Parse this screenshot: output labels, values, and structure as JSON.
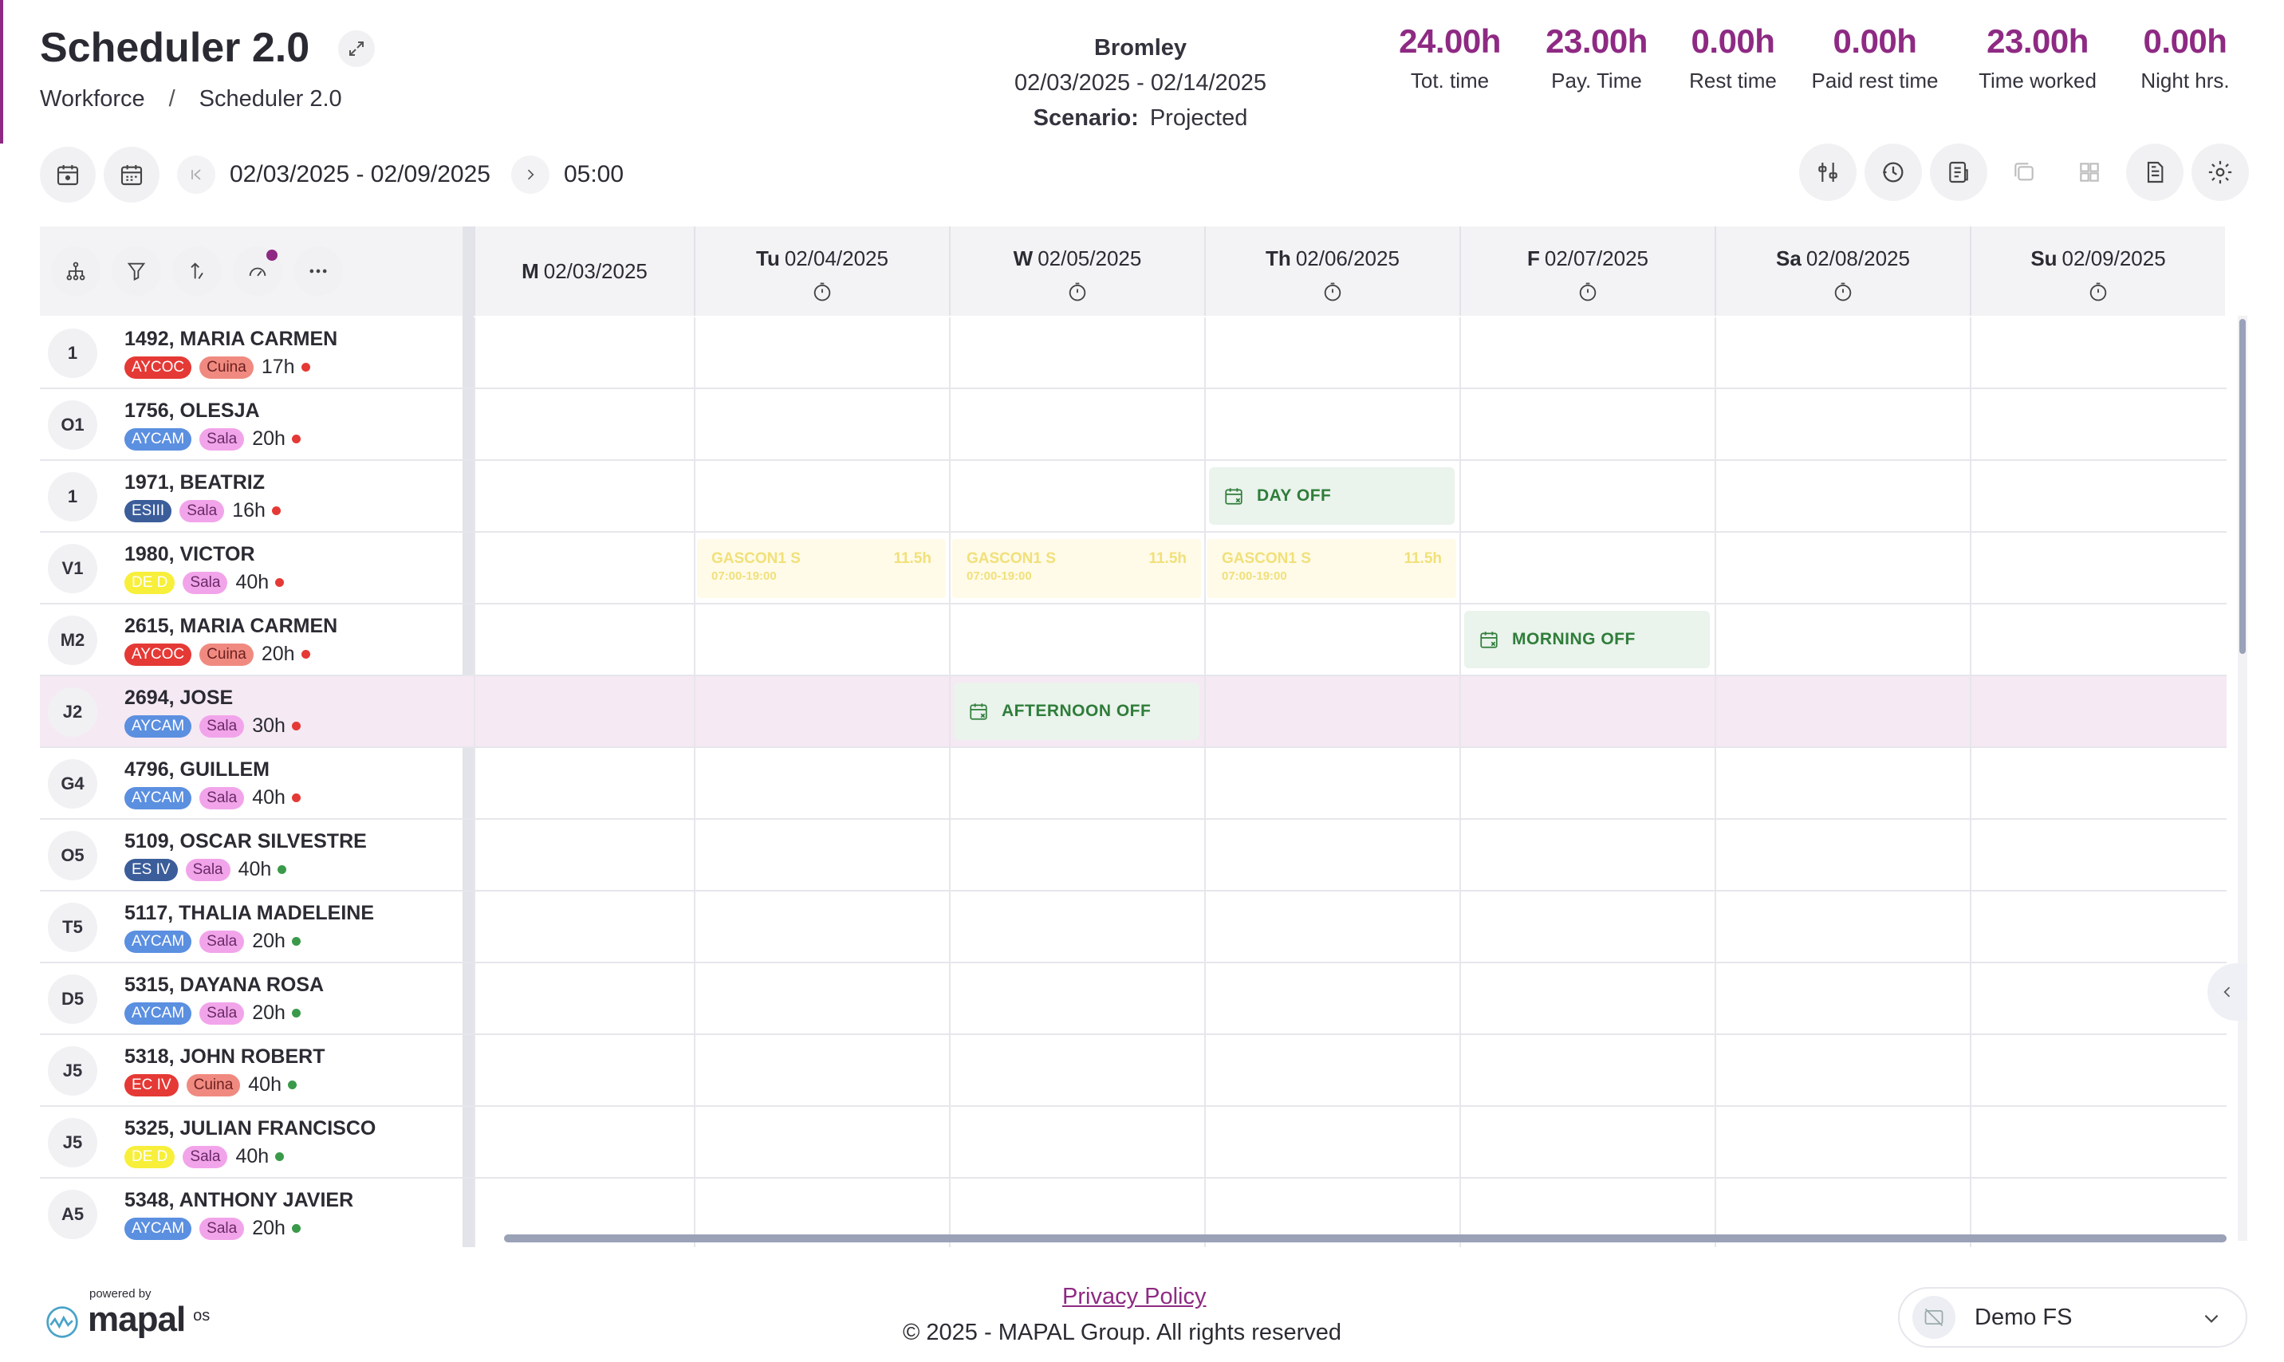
{
  "header": {
    "title": "Scheduler 2.0",
    "breadcrumb": [
      "Workforce",
      "Scheduler 2.0"
    ],
    "breadcrumb_sep": "/",
    "location": "Bromley",
    "period": "02/03/2025 - 02/14/2025",
    "scenario_label": "Scenario:",
    "scenario_value": "Projected"
  },
  "kpis": [
    {
      "value": "24.00h",
      "label": "Tot. time"
    },
    {
      "value": "23.00h",
      "label": "Pay. Time"
    },
    {
      "value": "0.00h",
      "label": "Rest time"
    },
    {
      "value": "0.00h",
      "label": "Paid rest time"
    },
    {
      "value": "23.00h",
      "label": "Time worked"
    },
    {
      "value": "0.00h",
      "label": "Night hrs."
    }
  ],
  "toolbar": {
    "range": "02/03/2025 - 02/09/2025",
    "time": "05:00"
  },
  "days": [
    {
      "abbr": "M",
      "date": "02/03/2025"
    },
    {
      "abbr": "Tu",
      "date": "02/04/2025"
    },
    {
      "abbr": "W",
      "date": "02/05/2025"
    },
    {
      "abbr": "Th",
      "date": "02/06/2025"
    },
    {
      "abbr": "F",
      "date": "02/07/2025"
    },
    {
      "abbr": "Sa",
      "date": "02/08/2025"
    },
    {
      "abbr": "Su",
      "date": "02/09/2025"
    }
  ],
  "employees": [
    {
      "avatar": "1",
      "name": "1492, MARIA CARMEN",
      "tag1": "AYCOC",
      "tag2": "Cuina",
      "hours": "17h",
      "status": "red"
    },
    {
      "avatar": "O1",
      "name": "1756, OLESJA",
      "tag1": "AYCAM",
      "tag2": "Sala",
      "hours": "20h",
      "status": "red"
    },
    {
      "avatar": "1",
      "name": "1971, BEATRIZ",
      "tag1": "ESIII",
      "tag2": "Sala",
      "hours": "16h",
      "status": "red"
    },
    {
      "avatar": "V1",
      "name": "1980, VICTOR",
      "tag1": "DE D",
      "tag2": "Sala",
      "hours": "40h",
      "status": "red"
    },
    {
      "avatar": "M2",
      "name": "2615, MARIA CARMEN",
      "tag1": "AYCOC",
      "tag2": "Cuina",
      "hours": "20h",
      "status": "red"
    },
    {
      "avatar": "J2",
      "name": "2694, JOSE",
      "tag1": "AYCAM",
      "tag2": "Sala",
      "hours": "30h",
      "status": "red"
    },
    {
      "avatar": "G4",
      "name": "4796, GUILLEM",
      "tag1": "AYCAM",
      "tag2": "Sala",
      "hours": "40h",
      "status": "red"
    },
    {
      "avatar": "O5",
      "name": "5109, OSCAR SILVESTRE",
      "tag1": "ES IV",
      "tag2": "Sala",
      "hours": "40h",
      "status": "green"
    },
    {
      "avatar": "T5",
      "name": "5117, THALIA MADELEINE",
      "tag1": "AYCAM",
      "tag2": "Sala",
      "hours": "20h",
      "status": "green"
    },
    {
      "avatar": "D5",
      "name": "5315, DAYANA ROSA",
      "tag1": "AYCAM",
      "tag2": "Sala",
      "hours": "20h",
      "status": "green"
    },
    {
      "avatar": "J5",
      "name": "5318, JOHN ROBERT",
      "tag1": "EC IV",
      "tag2": "Cuina",
      "hours": "40h",
      "status": "green"
    },
    {
      "avatar": "J5",
      "name": "5325, JULIAN FRANCISCO",
      "tag1": "DE D",
      "tag2": "Sala",
      "hours": "40h",
      "status": "green"
    },
    {
      "avatar": "A5",
      "name": "5348, ANTHONY JAVIER",
      "tag1": "AYCAM",
      "tag2": "Sala",
      "hours": "20h",
      "status": "green"
    }
  ],
  "shifts": [
    {
      "row": 3,
      "day": 1,
      "title": "GASCON1 S",
      "time": "07:00-19:00",
      "hours": "11.5h"
    },
    {
      "row": 3,
      "day": 2,
      "title": "GASCON1 S",
      "time": "07:00-19:00",
      "hours": "11.5h"
    },
    {
      "row": 3,
      "day": 3,
      "title": "GASCON1 S",
      "time": "07:00-19:00",
      "hours": "11.5h"
    }
  ],
  "absences": [
    {
      "row": 2,
      "day": 3,
      "label": "DAY OFF"
    },
    {
      "row": 4,
      "day": 4,
      "label": "MORNING OFF"
    },
    {
      "row": 5,
      "day": 2,
      "label": "AFTERNOON OFF"
    }
  ],
  "highlight_row": 5,
  "footer": {
    "powered_by": "powered by",
    "brand": "mapal",
    "brand_suffix": "os",
    "privacy": "Privacy Policy",
    "copyright": "© 2025 - MAPAL Group. All rights reserved",
    "company": "Demo FS"
  },
  "colors": {
    "accent": "#8e2a83",
    "tag_aycoc": "#e53935",
    "tag_aycam": "#5b8fe0",
    "tag_es": "#3b5d9a",
    "tag_ded": "#f7ef3a",
    "tag_ec": "#e53935",
    "tag_cuina": "#f08a80",
    "tag_sala": "#f2a4ea",
    "status_red": "#e53935",
    "status_green": "#3a9a4a"
  }
}
